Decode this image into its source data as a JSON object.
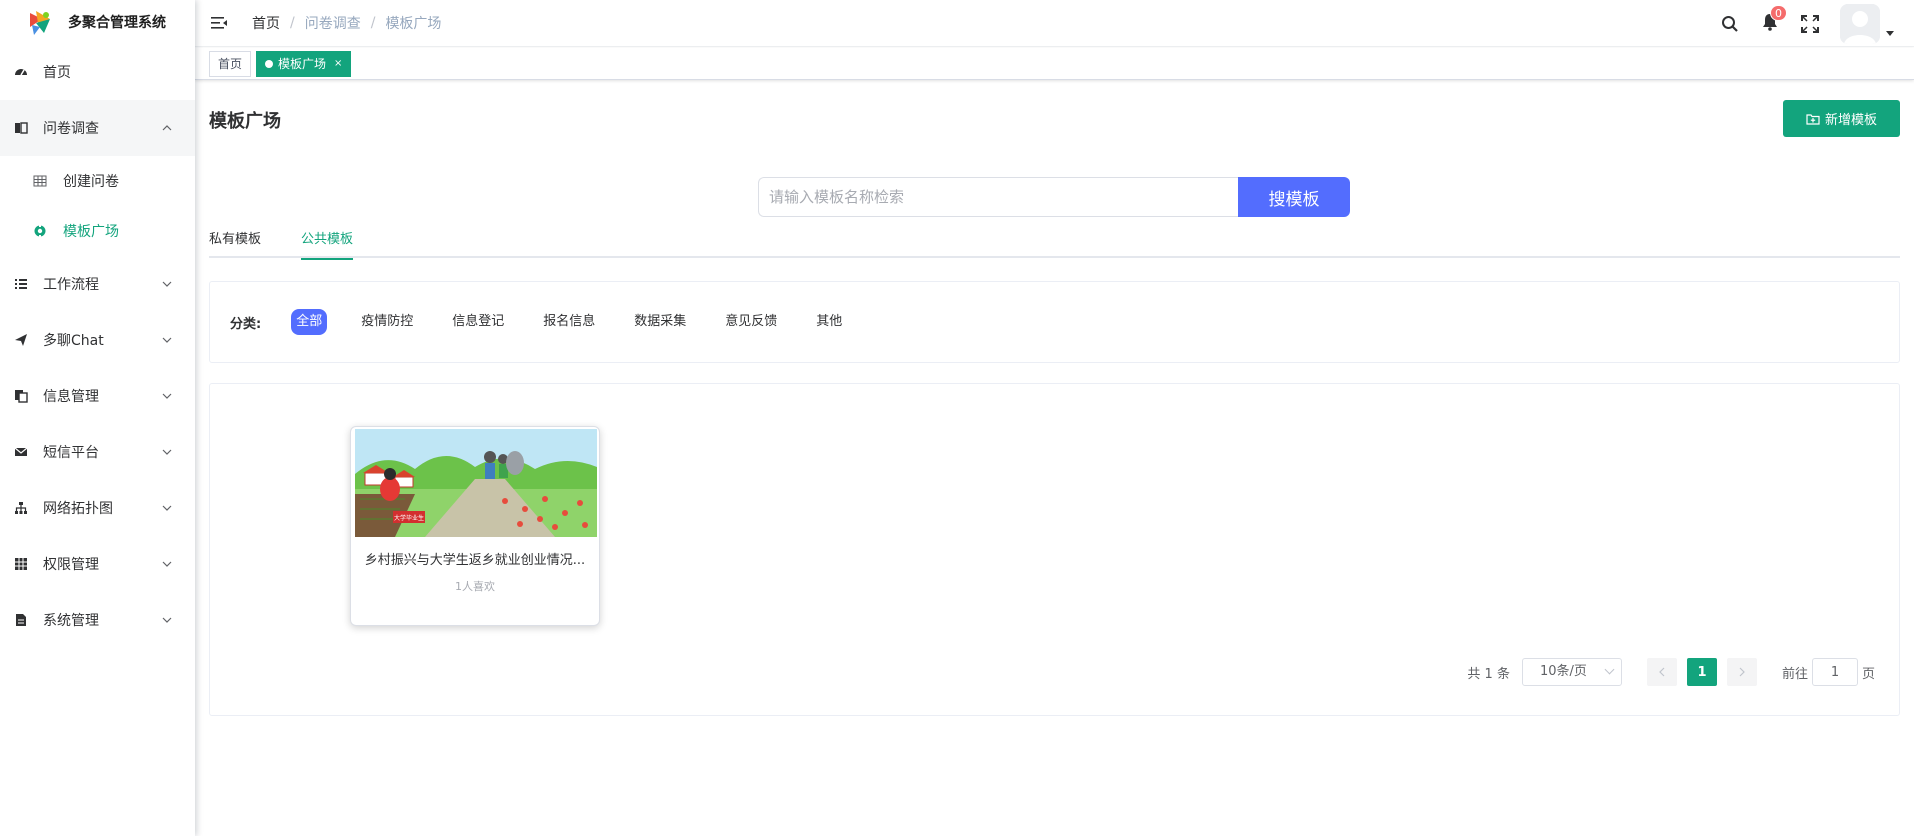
{
  "app": {
    "title": "多聚合管理系统"
  },
  "sidebar": {
    "items": [
      {
        "label": "首页",
        "icon": "dashboard-icon"
      },
      {
        "label": "问卷调查",
        "icon": "survey-icon",
        "open": true,
        "children": [
          {
            "label": "创建问卷",
            "icon": "table-icon"
          },
          {
            "label": "模板广场",
            "icon": "gear-icon",
            "active": true
          }
        ]
      },
      {
        "label": "工作流程",
        "icon": "list-icon"
      },
      {
        "label": "多聊Chat",
        "icon": "send-icon"
      },
      {
        "label": "信息管理",
        "icon": "copy-icon"
      },
      {
        "label": "短信平台",
        "icon": "mail-icon"
      },
      {
        "label": "网络拓扑图",
        "icon": "tree-icon"
      },
      {
        "label": "权限管理",
        "icon": "grid-icon"
      },
      {
        "label": "系统管理",
        "icon": "document-icon"
      }
    ]
  },
  "breadcrumb": [
    "首页",
    "问卷调查",
    "模板广场"
  ],
  "header": {
    "notification_count": "0"
  },
  "tags": [
    {
      "label": "首页",
      "active": false
    },
    {
      "label": "模板广场",
      "active": true,
      "close": "×"
    }
  ],
  "page": {
    "title": "模板广场",
    "add_button": "新增模板",
    "search": {
      "placeholder": "请输入模板名称检索",
      "button": "搜模板"
    },
    "tabs": [
      {
        "label": "私有模板",
        "active": false
      },
      {
        "label": "公共模板",
        "active": true
      }
    ],
    "filter": {
      "label": "分类:",
      "categories": [
        "全部",
        "疫情防控",
        "信息登记",
        "报名信息",
        "数据采集",
        "意见反馈",
        "其他"
      ],
      "active_index": 0
    },
    "cards": [
      {
        "name": "乡村振兴与大学生返乡就业创业情况...",
        "likes": "1人喜欢",
        "image_text": "大学毕业生"
      }
    ],
    "pagination": {
      "total": "共 1 条",
      "page_size": "10条/页",
      "current": "1",
      "goto_label": "前往",
      "goto_value": "1",
      "page_suffix": "页"
    }
  },
  "colors": {
    "primary": "#13a47d",
    "accent": "#536dfe",
    "badge": "#f56c6c"
  }
}
